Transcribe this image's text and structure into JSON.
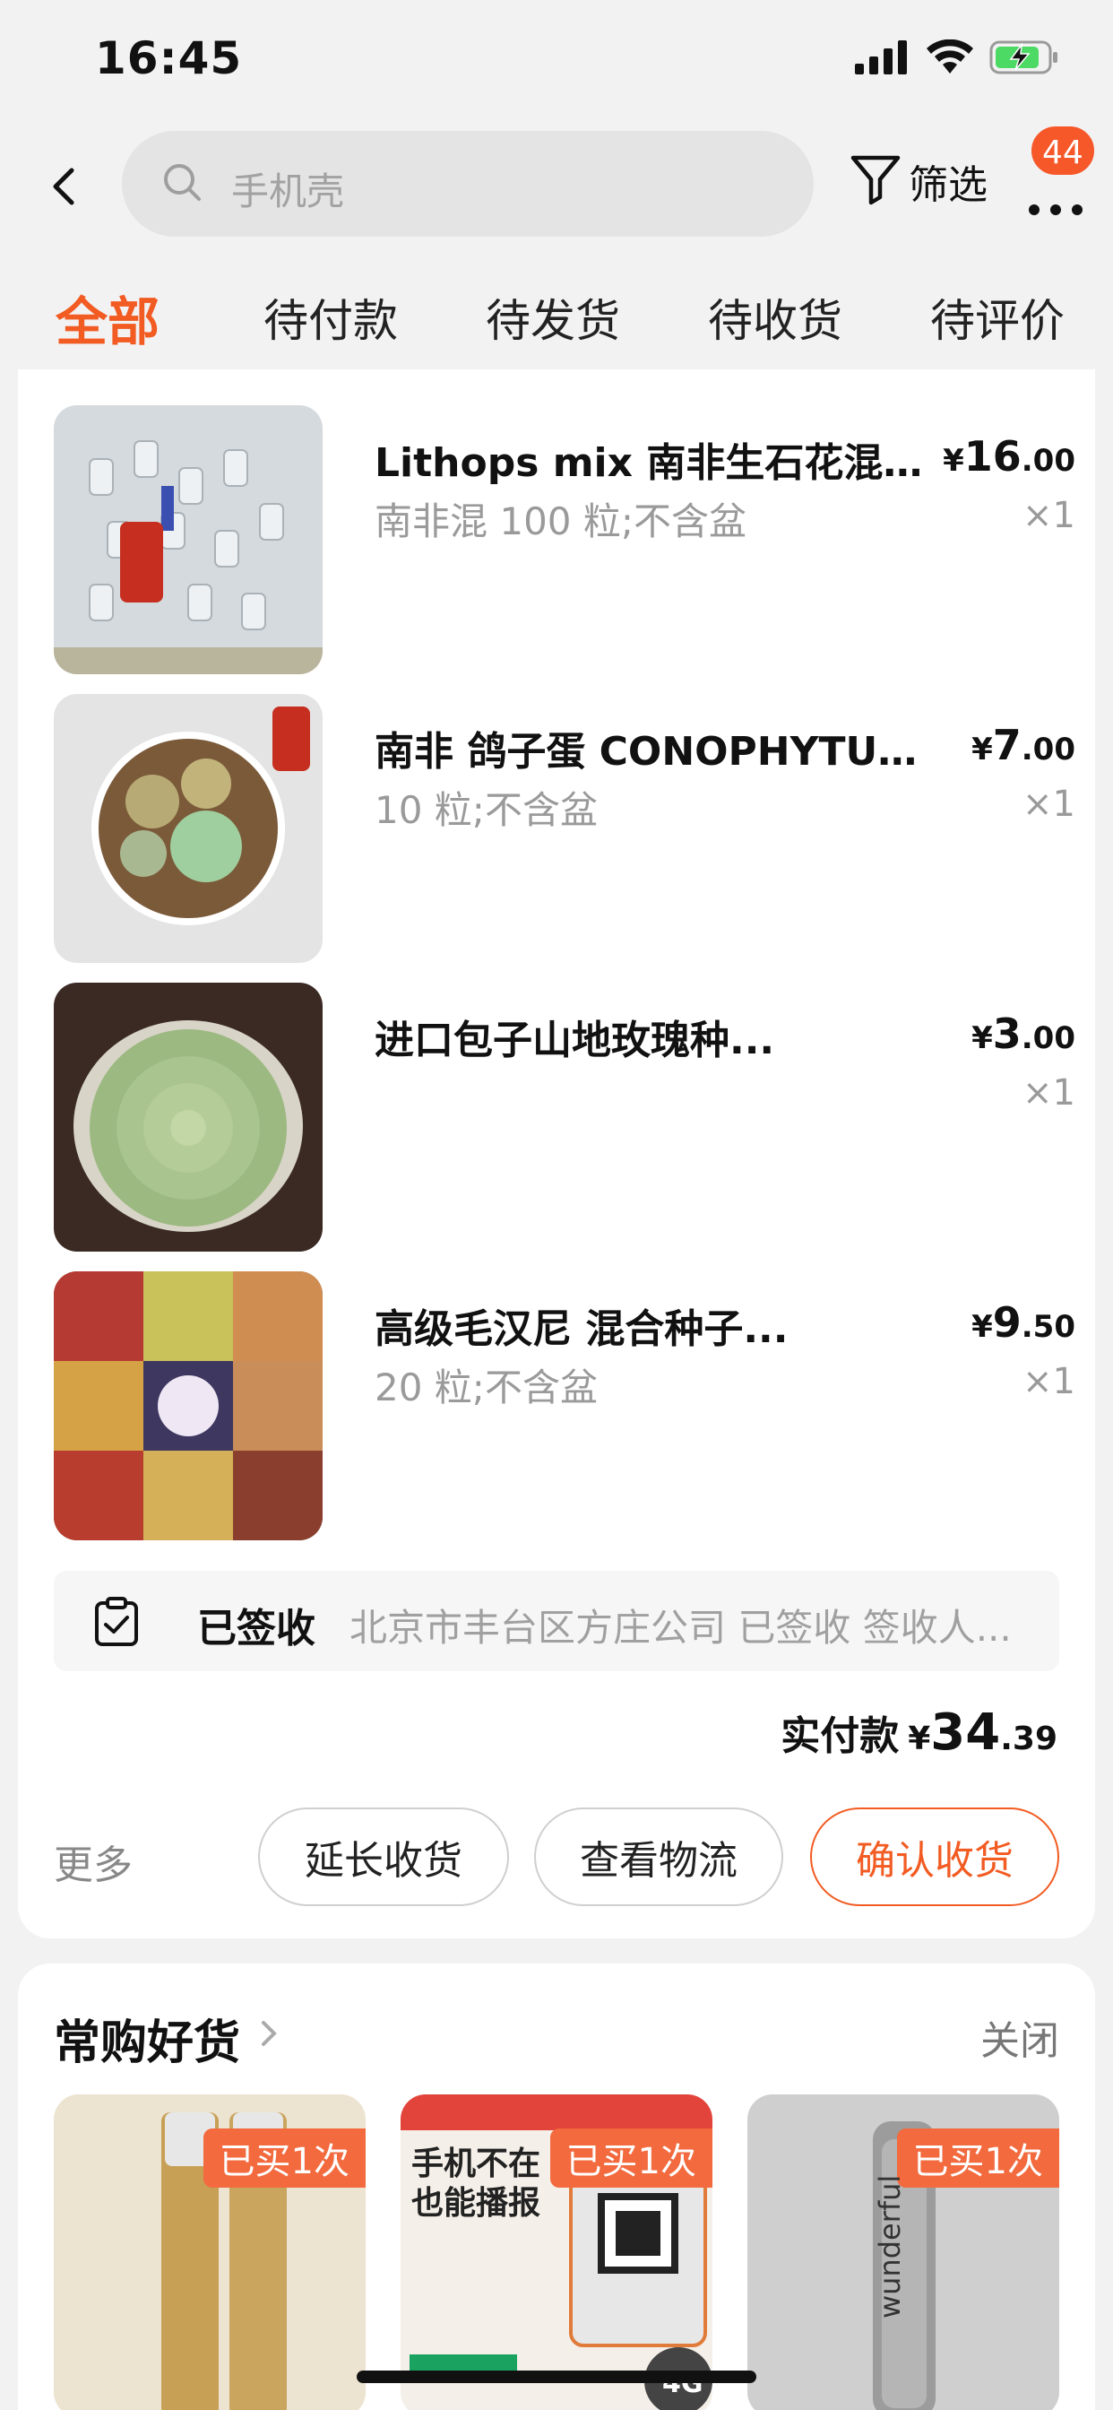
{
  "status_bar": {
    "time": "16:45"
  },
  "search": {
    "placeholder": "手机壳"
  },
  "header": {
    "filter_label": "筛选",
    "badge_count": "44"
  },
  "tabs": [
    {
      "label": "全部",
      "active": true
    },
    {
      "label": "待付款"
    },
    {
      "label": "待发货"
    },
    {
      "label": "待收货"
    },
    {
      "label": "待评价"
    }
  ],
  "order": {
    "items": [
      {
        "title": "Lithops mix 南非生石花混合...",
        "spec": "南非混 100 粒;不含盆",
        "price_symbol": "¥",
        "price_int": "16",
        "price_dec": ".00",
        "qty": "×1"
      },
      {
        "title": "南非 鸽子蛋 CONOPHYTUM...",
        "spec": "10 粒;不含盆",
        "price_symbol": "¥",
        "price_int": "7",
        "price_dec": ".00",
        "qty": "×1"
      },
      {
        "title": "进口包子山地玫瑰种...",
        "spec": "",
        "price_symbol": "¥",
        "price_int": "3",
        "price_dec": ".00",
        "qty": "×1"
      },
      {
        "title": "高级毛汉尼 混合种子...",
        "spec": "20 粒;不含盆",
        "price_symbol": "¥",
        "price_int": "9",
        "price_dec": ".50",
        "qty": "×1"
      }
    ],
    "logistics": {
      "status": "已签收",
      "detail": "北京市丰台区方庄公司 已签收 签收人..."
    },
    "paid": {
      "label": "实付款",
      "symbol": "¥",
      "int": "34",
      "dec": ".39"
    },
    "more_label": "更多",
    "actions": {
      "extend": "延长收货",
      "logistics": "查看物流",
      "confirm": "确认收货"
    }
  },
  "recommend": {
    "title": "常购好货",
    "close_label": "关闭",
    "items": [
      {
        "badge": "已买1次",
        "image_text": ""
      },
      {
        "badge": "已买1次",
        "image_text": "手机不在 也能播报"
      },
      {
        "badge": "已买1次",
        "image_text": "wunderful"
      }
    ]
  },
  "colors": {
    "accent": "#f25b22",
    "badge": "#f26a3e"
  }
}
